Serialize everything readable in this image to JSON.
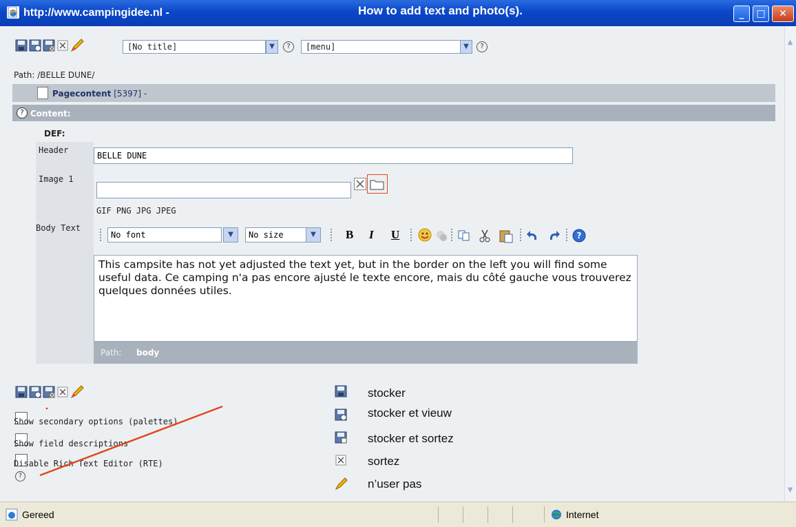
{
  "window": {
    "url": "http://www.campingidee.nl -",
    "caption": "How to add text and photo(s).",
    "min": "_",
    "max": "□",
    "close": "✕"
  },
  "toolbar": {
    "title_select": "[No title]",
    "menu_select": "[menu]",
    "help": "?"
  },
  "path": "Path: /BELLE DUNE/",
  "pagecontent": {
    "label": "Pagecontent",
    "id": "[5397] -"
  },
  "content_label": "Content:",
  "def_label": "DEF:",
  "header": {
    "label": "Header",
    "value": "BELLE DUNE"
  },
  "image": {
    "label": "Image 1",
    "value": "",
    "types": "GIF PNG JPG JPEG"
  },
  "body": {
    "label": "Body Text",
    "font": "No font",
    "size": "No size",
    "bold": "B",
    "italic": "I",
    "underline": "U",
    "text": "This campsite has not yet adjusted the text yet, but in the border on the left you will find some useful data. Ce camping n'a pas encore ajusté le texte encore, mais du côté gauche vous trouverez quelques données utiles.",
    "path_label": "Path:",
    "path_value": "body"
  },
  "options": {
    "secondary": "Show secondary options (palettes)",
    "descriptions": "Show field descriptions",
    "rte": "Disable Rich Text Editor (RTE)"
  },
  "legend": [
    {
      "icon": "save-icon",
      "label": "stocker"
    },
    {
      "icon": "save-view-icon",
      "label": "stocker et vieuw"
    },
    {
      "icon": "save-close-icon",
      "label": "stocker et sortez"
    },
    {
      "icon": "close-icon",
      "label": "sortez"
    },
    {
      "icon": "pencil-icon",
      "label": "n’user pas"
    }
  ],
  "status": {
    "left": "Gereed",
    "zone": "Internet"
  },
  "colors": {
    "titlebar": "#0a47c9",
    "section": "#bfc6ce",
    "accent_red": "#e2461c"
  }
}
